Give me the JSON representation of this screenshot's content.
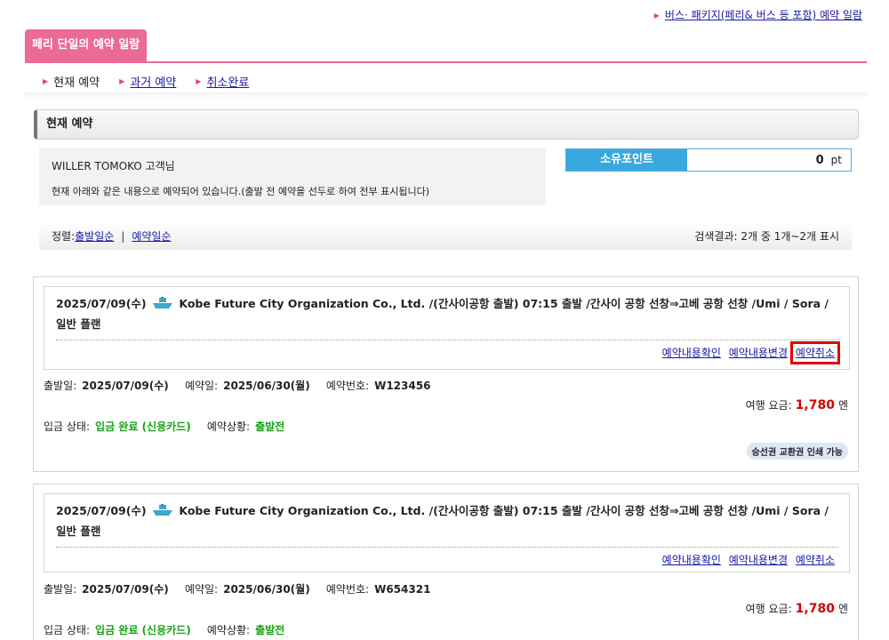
{
  "top_link": {
    "label": "버스· 패키지(페리& 버스 등 포함) 예약 일람"
  },
  "brand_tab": {
    "title": "페리 단일의 예약 일람"
  },
  "subnav": {
    "current": "현재 예약",
    "past": "과거 예약",
    "cancelled": "취소완료"
  },
  "section": {
    "title": "현재 예약"
  },
  "customer": {
    "greeting": "WILLER TOMOKO 고객님",
    "message": "현재 아래와 같은 내용으로 예약되어 있습니다.(출발 전 예약을 선두로 하여 전부 표시됩니다)"
  },
  "points": {
    "label": "소유포인트",
    "value": "0",
    "unit": "pt"
  },
  "sort": {
    "prefix": "정렬:",
    "by_departure": "출발일순",
    "separator": "|",
    "by_booking": "예약일순",
    "result": "검색결과: 2개 중 1개~2개 표시"
  },
  "reservations": [
    {
      "date_prefix": "2025/07/09(수)",
      "title_rest": "Kobe Future City Organization Co., Ltd. /(간사이공항 출발) 07:15 출발 /간사이 공항 선창⇒고베 공항 선창 /Umi / Sora /일반 플랜",
      "link_confirm": "예약내용확인",
      "link_change": "예약내용변경",
      "link_cancel": "예약취소",
      "departure_label": "출발일:",
      "departure": "2025/07/09(수)",
      "booked_label": "예약일:",
      "booked": "2025/06/30(월)",
      "number_label": "예약번호:",
      "number": "W123456",
      "fare_label": "여행 요금:",
      "fare": "1,780",
      "fare_unit": "엔",
      "payment_label": "입금 상태:",
      "payment": "입금 완료 (신용카드)",
      "status_label": "예약상황:",
      "status": "출발전",
      "badge": "승선권 교환권 인쇄 가능"
    },
    {
      "date_prefix": "2025/07/09(수)",
      "title_rest": "Kobe Future City Organization Co., Ltd. /(간사이공항 출발) 07:15 출발 /간사이 공항 선창⇒고베 공항 선창 /Umi / Sora /일반 플랜",
      "link_confirm": "예약내용확인",
      "link_change": "예약내용변경",
      "link_cancel": "예약취소",
      "departure_label": "출발일:",
      "departure": "2025/07/09(수)",
      "booked_label": "예약일:",
      "booked": "2025/06/30(월)",
      "number_label": "예약번호:",
      "number": "W654321",
      "fare_label": "여행 요금:",
      "fare": "1,780",
      "fare_unit": "엔",
      "payment_label": "입금 상태:",
      "payment": "입금 완료 (신용카드)",
      "status_label": "예약상황:",
      "status": "출발전"
    }
  ],
  "icons": {
    "ferry": "ferry-icon",
    "arrow": "pink-triangle-icon"
  },
  "colors": {
    "brand": "#ec6a96",
    "points": "#3aa8e0",
    "fare": "#d30000",
    "paid": "#17a317",
    "highlight": "#e00000"
  }
}
